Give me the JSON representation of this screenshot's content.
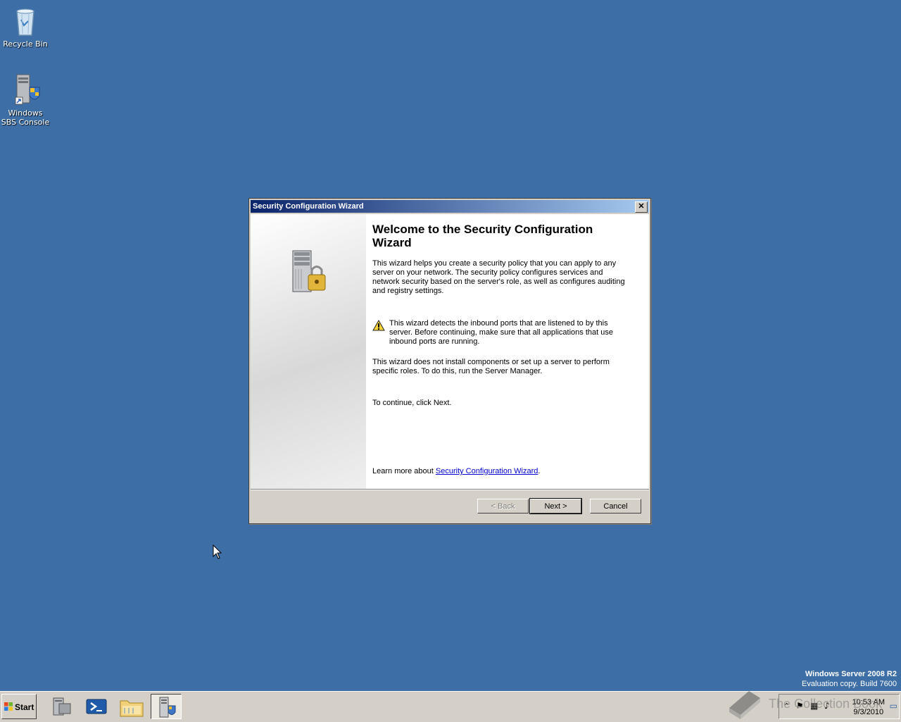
{
  "desktop": {
    "icons": [
      {
        "label": "Recycle Bin",
        "icon": "recycle-bin-icon"
      },
      {
        "label": "Windows SBS Console",
        "icon": "sbs-console-icon"
      }
    ],
    "branding": {
      "product": "Windows Server 2008 R2",
      "build": "Evaluation copy. Build 7600"
    }
  },
  "dialog": {
    "title": "Security Configuration Wizard",
    "close_label": "✕",
    "heading": "Welcome to the Security Configuration Wizard",
    "para1": "This wizard helps you create a security policy that you can apply to any server on your network. The security policy configures services and network security based on the server's role, as well as configures auditing and registry settings.",
    "warning": "This wizard detects the inbound ports that are listened to by this server. Before continuing, make sure that all applications that use inbound ports are running.",
    "para2": "This wizard does not install components or set up a server to perform specific roles. To do this, run the Server Manager.",
    "para3": "To continue, click Next.",
    "learn_more_prefix": "Learn more about ",
    "learn_more_link": "Security Configuration Wizard",
    "learn_more_suffix": ".",
    "buttons": {
      "back": "< Back",
      "next": "Next >",
      "cancel": "Cancel"
    }
  },
  "taskbar": {
    "start_label": "Start",
    "items": [
      "server-manager-icon",
      "powershell-icon",
      "explorer-icon",
      "security-wizard-icon"
    ],
    "clock_time": "10:53 AM",
    "clock_date": "9/3/2010"
  },
  "watermark": "The Collection Book",
  "colors": {
    "desktop": "#3d6ea5",
    "titlebar_start": "#0a246a",
    "titlebar_end": "#a6caf0",
    "dialog_face": "#d4d0c8"
  }
}
